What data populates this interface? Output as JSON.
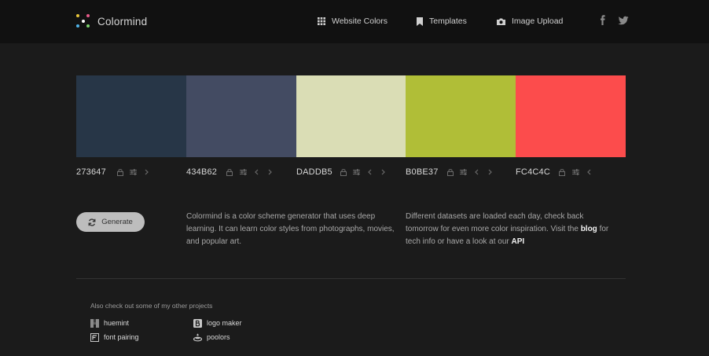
{
  "brand": {
    "name": "Colormind",
    "logo_dot_colors": [
      "#e8c63a",
      "#e85a8a",
      "#4fb3e8",
      "#7ad16b",
      "#e87a3a",
      "#ffffff"
    ]
  },
  "nav": {
    "website_colors": "Website Colors",
    "templates": "Templates",
    "image_upload": "Image Upload"
  },
  "social": [
    "facebook-icon",
    "twitter-icon"
  ],
  "palette": [
    {
      "hex": "273647",
      "color": "#273647"
    },
    {
      "hex": "434B62",
      "color": "#434b62"
    },
    {
      "hex": "DADDB5",
      "color": "#daddb5"
    },
    {
      "hex": "B0BE37",
      "color": "#b0be37"
    },
    {
      "hex": "FC4C4C",
      "color": "#fc4c4c"
    }
  ],
  "generate_label": "Generate",
  "description_left": "Colormind is a color scheme generator that uses deep learning. It can learn color styles from photographs, movies, and popular art.",
  "description_right": {
    "text_1": "Different datasets are loaded each day, check back tomorrow for even more color inspiration. Visit the ",
    "blog_link": "blog",
    "text_2": " for tech info or have a look at our ",
    "api_link": "API"
  },
  "other_projects": {
    "heading": "Also check out some of my other projects",
    "items": [
      "huemint",
      "font pairing",
      "logo maker",
      "poolors"
    ]
  }
}
